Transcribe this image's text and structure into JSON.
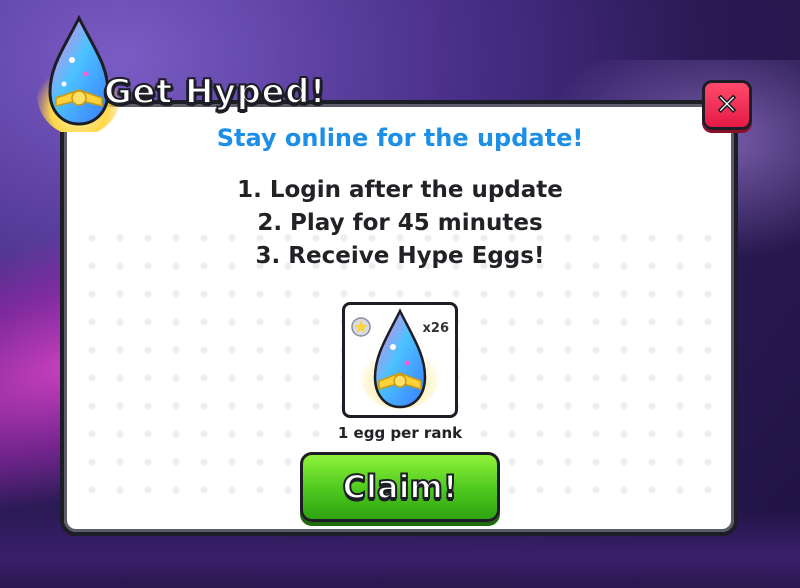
{
  "dialog": {
    "title": "Get Hyped!",
    "subtitle": "Stay online for the update!",
    "steps": [
      "1. Login after the update",
      "2. Play for 45 minutes",
      "3. Receive Hype Eggs!"
    ],
    "close_label": "✕",
    "reward": {
      "icon": "hype-egg-icon",
      "quantity": "x26",
      "note": "1 egg per rank"
    },
    "claim_label": "Claim!"
  },
  "colors": {
    "subtitle": "#1e8fe6",
    "close_button": "#e41a46",
    "claim_button": "#4cc81e",
    "background": "#2a1a55"
  }
}
